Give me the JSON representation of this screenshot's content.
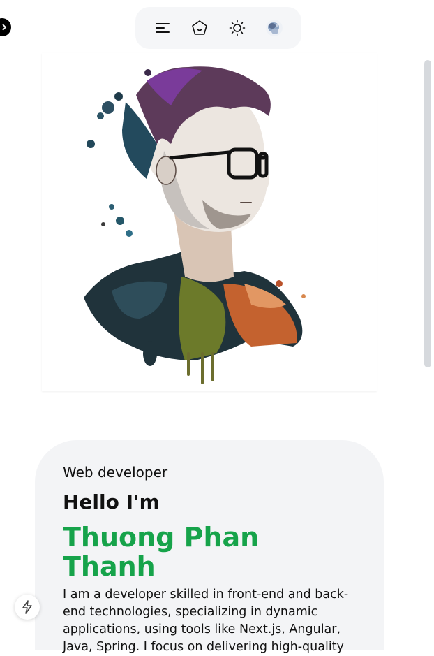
{
  "toolbar": {
    "menu_icon": "menu-icon",
    "home_icon": "home-pentagon-icon",
    "theme_icon": "sun-icon",
    "profile_icon": "avatar"
  },
  "left_toggle_icon": "chevron-right-icon",
  "hero": {
    "role": "Web developer",
    "greeting": "Hello I'm",
    "name": "Thuong Phan Thanh",
    "bio": "I am a developer skilled in front-end and back-end technologies, specializing in dynamic applications, using tools like Next.js, Angular, Java, Spring. I focus on delivering high-quality"
  },
  "colors": {
    "accent": "#16a34a",
    "card_bg": "#f3f4f6",
    "toolbar_bg": "#f5f6f8"
  },
  "bolt_button_icon": "lightning-icon"
}
